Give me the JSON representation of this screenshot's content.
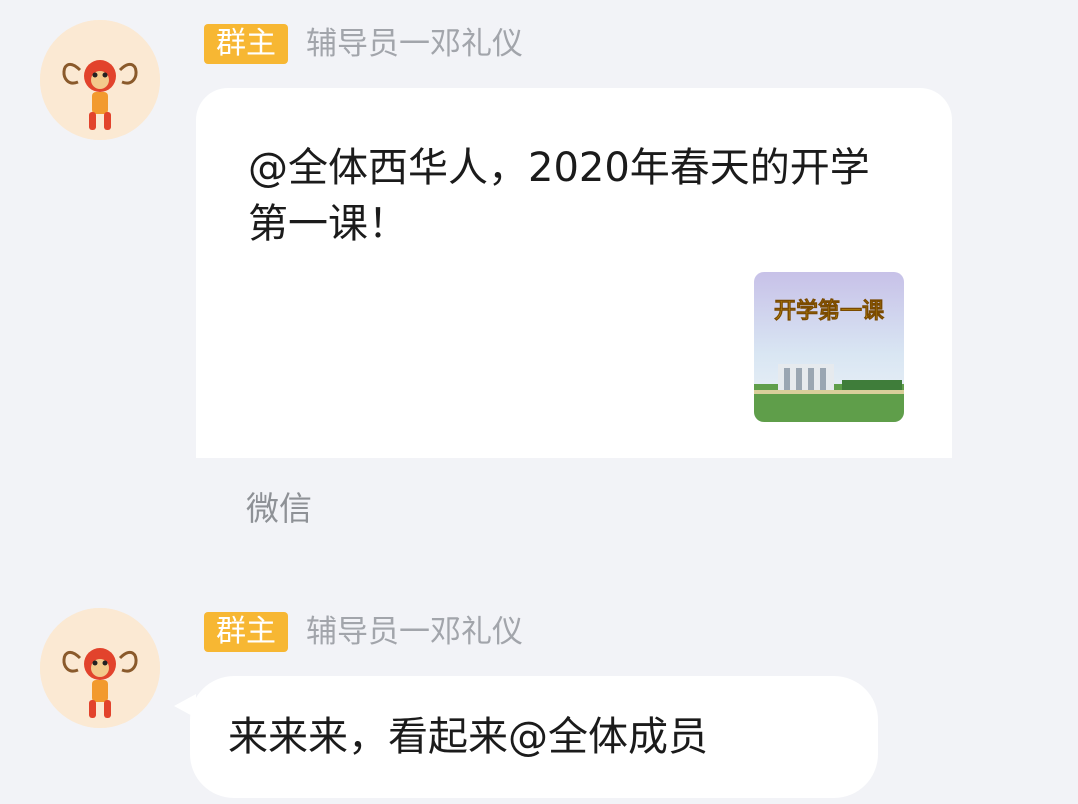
{
  "messages": [
    {
      "badge": "群主",
      "sender": "辅导员一邓礼仪",
      "card": {
        "text": "@全体西华人，2020年春天的开学第一课！",
        "thumbnail_caption": "开学第一课",
        "source": "微信"
      }
    },
    {
      "badge": "群主",
      "sender": "辅导员一邓礼仪",
      "text": "来来来，看起来@全体成员"
    }
  ],
  "colors": {
    "background": "#f2f3f7",
    "badge": "#f7b733",
    "name": "#a2a5ab",
    "bubble": "#ffffff"
  }
}
